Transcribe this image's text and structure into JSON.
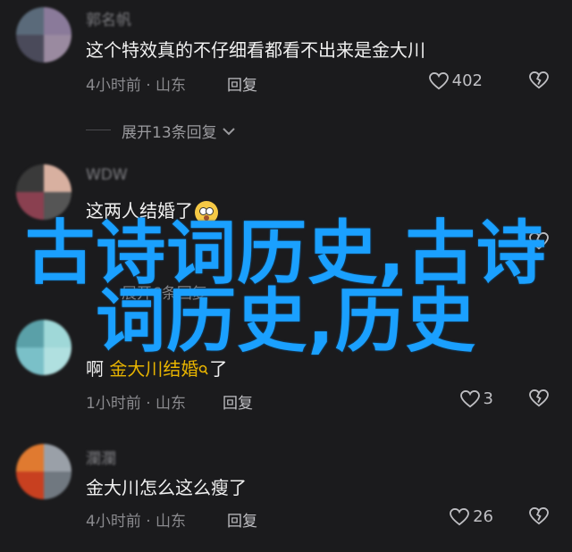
{
  "comments": [
    {
      "username": "郭名帆",
      "text": "这个特效真的不仔细看都看不出来是金大川",
      "time_location": "4小时前 · 山东",
      "reply_label": "回复",
      "likes": "402",
      "expand_label": "展开13条回复",
      "avatar_colors": [
        "#5a6a7a",
        "#8a7a9a",
        "#4a4a5a",
        "#9a8aa0"
      ]
    },
    {
      "username": "WDW",
      "text": "这两人结婚了",
      "time_location": "",
      "reply_label": "",
      "likes": "",
      "expand_label": "展开6条回复",
      "avatar_colors": [
        "#3a3a3a",
        "#d8b0a0",
        "#8a4050",
        "#555555"
      ]
    },
    {
      "username": "",
      "text_prefix": "啊",
      "text_highlight": "金大川结婚",
      "text_suffix": "了",
      "time_location": "1小时前 · 山东",
      "reply_label": "回复",
      "likes": "3",
      "avatar_colors": [
        "#5aa0a8",
        "#9fd8d8",
        "#7ac0c8",
        "#b0e0e0"
      ]
    },
    {
      "username": "瀾瀾",
      "text": "金大川怎么这么瘦了",
      "time_location": "4小时前 · 山东",
      "reply_label": "回复",
      "likes": "26",
      "avatar_colors": [
        "#e07a30",
        "#9aa0a8",
        "#c84020",
        "#707880"
      ]
    }
  ],
  "overlay": {
    "line1": "古诗词历史,古诗",
    "line2": "词历史,历史"
  },
  "colors": {
    "overlay": "#1aa0ff",
    "highlight": "#e8b400",
    "background": "#1b1b1d"
  }
}
